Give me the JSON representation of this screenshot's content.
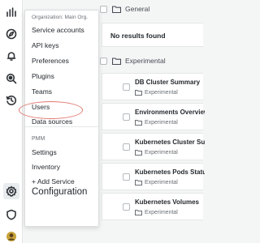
{
  "menu": {
    "heading": "Organization: Main Org.",
    "items": [
      {
        "label": "Service accounts"
      },
      {
        "label": "API keys"
      },
      {
        "label": "Preferences"
      },
      {
        "label": "Plugins"
      },
      {
        "label": "Teams"
      },
      {
        "label": "Users"
      },
      {
        "label": "Data sources"
      }
    ],
    "section_label": "PMM",
    "pmm_items": [
      {
        "label": "Settings"
      },
      {
        "label": "Inventory"
      },
      {
        "label": "+ Add Service"
      }
    ],
    "footer_title": "Configuration"
  },
  "dashboards": {
    "general_folder": "General",
    "no_results": "No results found",
    "experimental_folder": "Experimental",
    "cards": [
      {
        "title": "DB Cluster Summary",
        "folder": "Experimental"
      },
      {
        "title": "Environments Overview",
        "folder": "Experimental"
      },
      {
        "title": "Kubernetes Cluster Summary",
        "folder": "Experimental"
      },
      {
        "title": "Kubernetes Pods Status",
        "folder": "Experimental"
      },
      {
        "title": "Kubernetes Volumes",
        "folder": "Experimental"
      }
    ]
  },
  "rail": {
    "icons": [
      "dashboards-icon",
      "explore-icon",
      "alerting-icon",
      "query-analytics-icon",
      "history-icon",
      "configuration-icon",
      "server-admin-icon",
      "user-avatar"
    ]
  },
  "colors": {
    "highlight": "#e0776f",
    "rail_bg": "#ffffff",
    "page_bg": "#f4f5f5"
  }
}
